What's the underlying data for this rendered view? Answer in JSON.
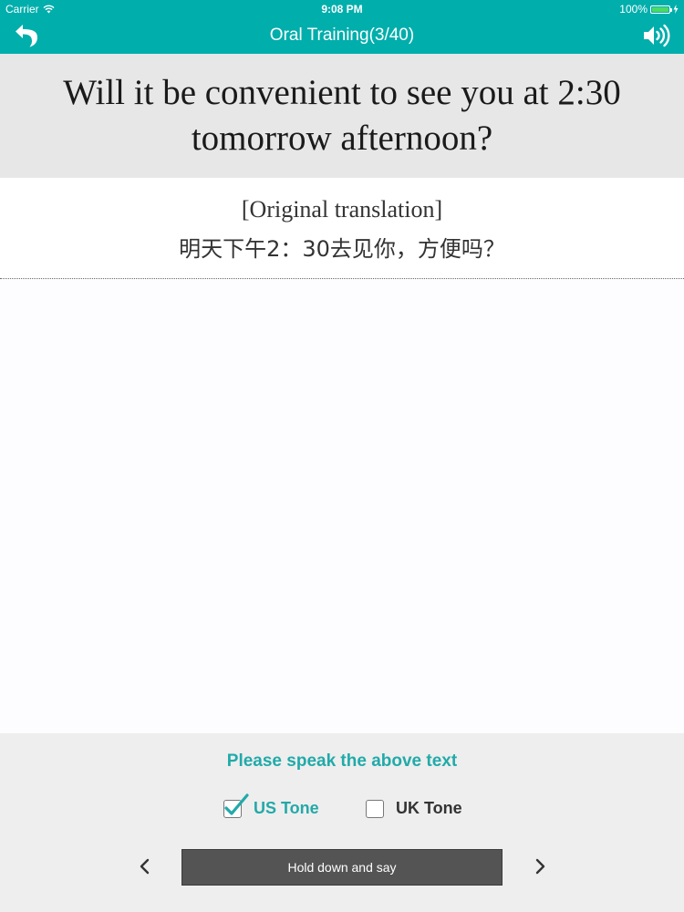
{
  "status_bar": {
    "carrier": "Carrier",
    "time": "9:08 PM",
    "battery": "100%"
  },
  "nav": {
    "title": "Oral Training(3/40)",
    "back_icon": "back-arrow-icon",
    "sound_icon": "speaker-icon"
  },
  "sentence": {
    "text": "Will it be convenient to see you at 2:30 tomorrow afternoon?"
  },
  "translation": {
    "label": "[Original translation]",
    "text": "明天下午2：30去见你，方便吗？"
  },
  "controls": {
    "prompt": "Please speak the above text",
    "tones": [
      {
        "label": "US Tone",
        "checked": true
      },
      {
        "label": "UK Tone",
        "checked": false
      }
    ],
    "hold_button": "Hold down and say",
    "prev_icon": "chevron-left-icon",
    "next_icon": "chevron-right-icon"
  },
  "colors": {
    "accent": "#00aeac",
    "accent_text": "#21aaa9",
    "hold_button_bg": "#545454"
  }
}
